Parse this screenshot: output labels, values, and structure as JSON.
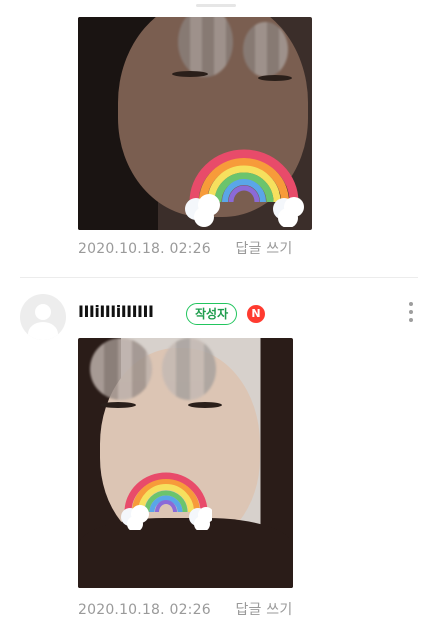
{
  "comments": [
    {
      "date": "2020.10.18. 02:26",
      "reply_label": "답글 쓰기"
    },
    {
      "username": "IIIiIIIiIIIIII",
      "author_badge": "작성자",
      "new_badge": "N",
      "date": "2020.10.18. 02:26",
      "reply_label": "답글 쓰기"
    }
  ],
  "icons": {
    "avatar": "default-avatar-icon",
    "more": "more-vertical-icon",
    "sticker": "rainbow-sticker-icon"
  },
  "colors": {
    "author_badge": "#22c55e",
    "new_badge": "#ff3b30",
    "meta_text": "#9a9a9a"
  }
}
